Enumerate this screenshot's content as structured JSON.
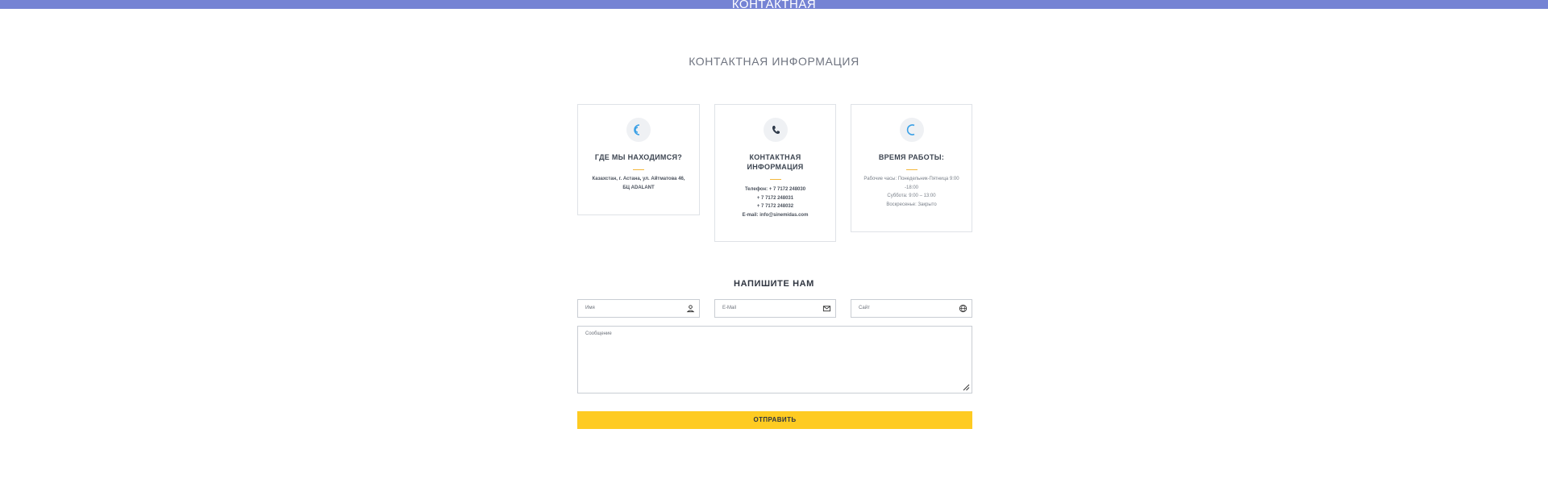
{
  "topbar": {
    "title": "КОНТАКТНАЯ"
  },
  "contact_section": {
    "title": "КОНТАКТНАЯ ИНФОРМАЦИЯ"
  },
  "cards": {
    "location": {
      "icon": "location-icon",
      "title": "ГДЕ МЫ НАХОДИМСЯ?",
      "address_line1": "Казахстан, г. Астана, ул. Айтматова 46,",
      "address_line2": "БЦ ADALANT"
    },
    "contacts": {
      "icon": "phone-icon",
      "title_line1": "КОНТАКТНАЯ",
      "title_line2": "ИНФОРМАЦИЯ",
      "phone1": "Телефон: + 7 7172 248030",
      "phone2": "+ 7 7172 248031",
      "phone3": "+ 7 7172 248032",
      "email": "E-mail: info@sinemidas.com"
    },
    "hours": {
      "icon": "clock-icon",
      "title": "ВРЕМЯ РАБОТЫ:",
      "line1": "Рабочие часы: Понедельник-Пятница 9:00",
      "line2": "-18:00",
      "line3": "Суббота: 9:00 – 13:00",
      "line4": "Воскресенье: Закрыто"
    }
  },
  "form": {
    "title": "НАПИШИТЕ НАМ",
    "name_placeholder": "Имя",
    "email_placeholder": "E-Mail",
    "site_placeholder": "Сайт",
    "message_placeholder": "Сообщение",
    "submit_label": "ОТПРАВИТЬ"
  },
  "colors": {
    "topbar": "#7583d4",
    "accent_icon": "#3aa0e6",
    "divider": "#f4b73b",
    "submit": "#fecb22"
  }
}
